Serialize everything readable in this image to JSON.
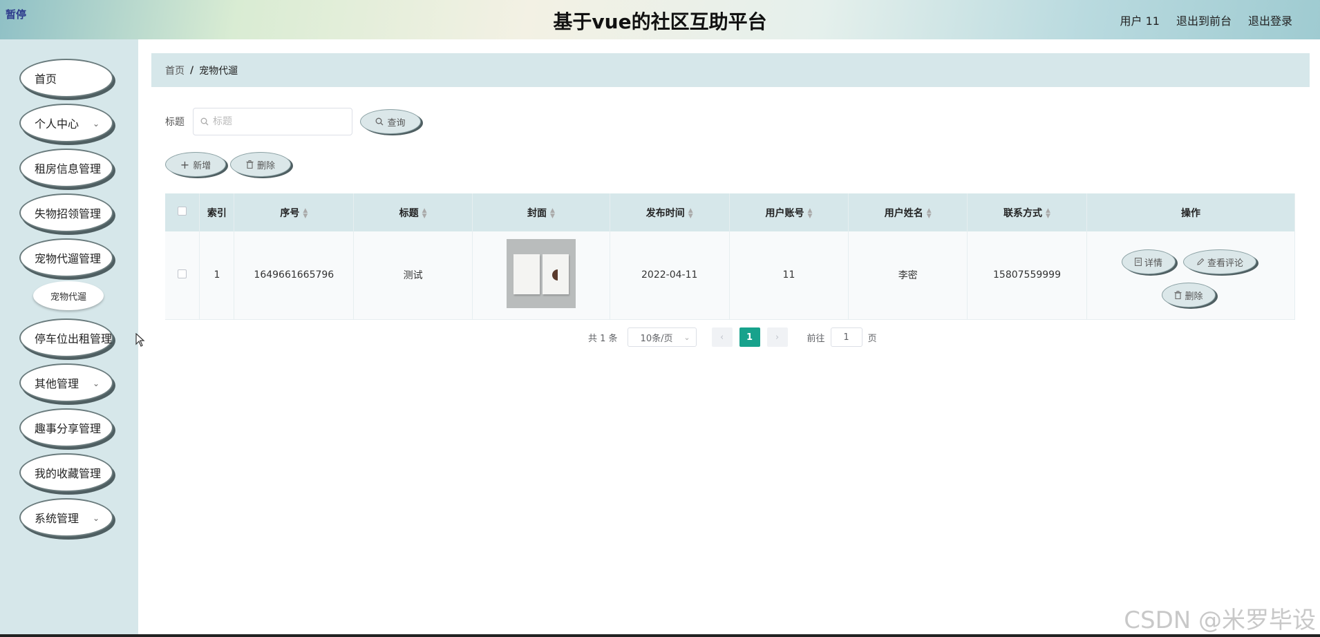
{
  "header": {
    "sticker": "暂停",
    "title": "基于vue的社区互助平台",
    "user_label": "用户 11",
    "back_to_front": "退出到前台",
    "logout": "退出登录"
  },
  "sidebar": {
    "items": [
      {
        "label": "首页"
      },
      {
        "label": "个人中心"
      },
      {
        "label": "租房信息管理"
      },
      {
        "label": "失物招领管理"
      },
      {
        "label": "宠物代遛管理"
      },
      {
        "label": "停车位出租管理"
      },
      {
        "label": "其他管理"
      },
      {
        "label": "趣事分享管理"
      },
      {
        "label": "我的收藏管理"
      },
      {
        "label": "系统管理"
      }
    ],
    "submenu": {
      "label": "宠物代遛"
    }
  },
  "breadcrumb": {
    "home": "首页",
    "separator": "/",
    "current": "宠物代遛"
  },
  "search": {
    "label": "标题",
    "placeholder": "标题",
    "value": "",
    "button": "查询"
  },
  "toolbar": {
    "add": "新增",
    "delete": "删除"
  },
  "table": {
    "headers": {
      "index": "索引",
      "serial": "序号",
      "title": "标题",
      "cover": "封面",
      "publish_time": "发布时间",
      "account": "用户账号",
      "name": "用户姓名",
      "contact": "联系方式",
      "actions": "操作"
    },
    "rows": [
      {
        "index": "1",
        "serial": "1649661665796",
        "title": "测试",
        "publish_time": "2022-04-11",
        "account": "11",
        "name": "李密",
        "contact": "15807559999",
        "actions": {
          "detail": "详情",
          "comments": "查看评论",
          "delete": "删除"
        }
      }
    ]
  },
  "pagination": {
    "total": "共 1 条",
    "page_size": "10条/页",
    "current": "1",
    "goto_prefix": "前往",
    "goto_value": "1",
    "goto_suffix": "页"
  },
  "watermark": "CSDN @米罗毕设",
  "colors": {
    "sidebar_bg": "#d6e7ea",
    "pager_active": "#17a28c",
    "button_bg": "#dbe7e9"
  }
}
